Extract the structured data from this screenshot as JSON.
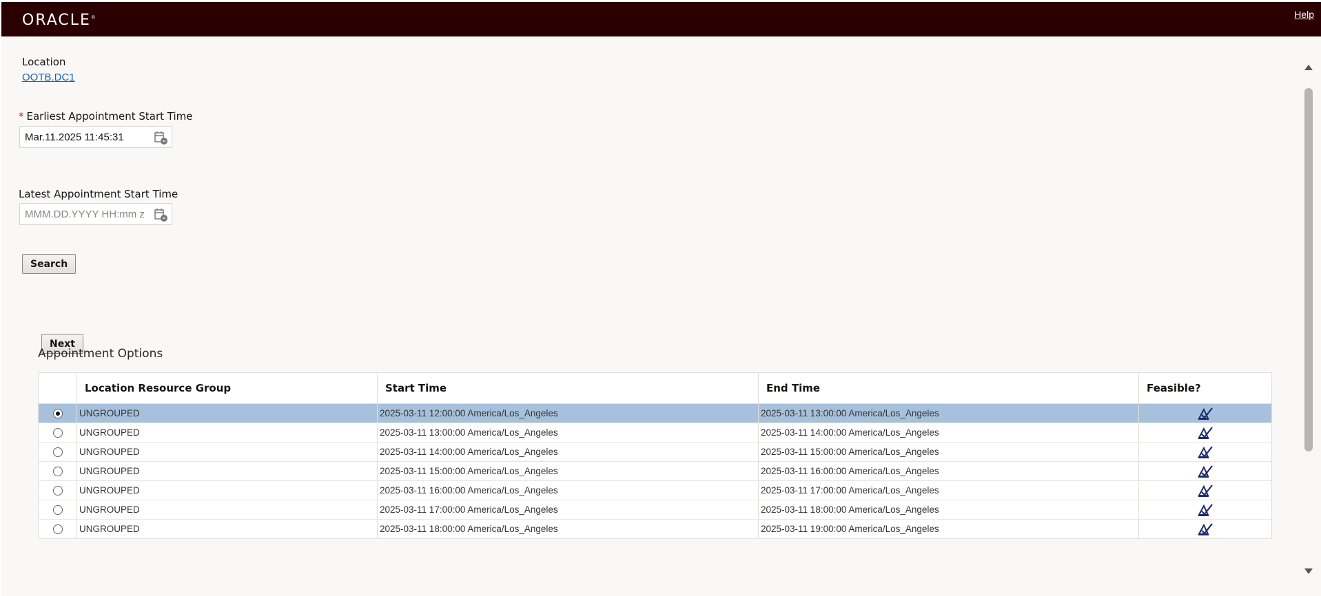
{
  "header": {
    "logo_text": "ORACLE",
    "logo_mark": "®",
    "help_label": "Help",
    "bar_color": "#2b0000"
  },
  "form": {
    "location_label": "Location",
    "location_value": "OOTB.DC1",
    "required_marker": "*",
    "earliest_label": "Earliest Appointment Start Time",
    "earliest_value": "Mar.11.2025 11:45:31",
    "latest_label": "Latest Appointment Start Time",
    "latest_placeholder": "MMM.DD.YYYY HH:mm z",
    "search_label": "Search"
  },
  "next_label": "Next",
  "appointments": {
    "title": "Appointment Options",
    "columns": [
      "Location Resource Group",
      "Start Time",
      "End Time",
      "Feasible?"
    ],
    "rows": [
      {
        "group": "UNGROUPED",
        "start": "2025-03-11 12:00:00 America/Los_Angeles",
        "end": "2025-03-11 13:00:00 America/Los_Angeles",
        "selected": true
      },
      {
        "group": "UNGROUPED",
        "start": "2025-03-11 13:00:00 America/Los_Angeles",
        "end": "2025-03-11 14:00:00 America/Los_Angeles",
        "selected": false
      },
      {
        "group": "UNGROUPED",
        "start": "2025-03-11 14:00:00 America/Los_Angeles",
        "end": "2025-03-11 15:00:00 America/Los_Angeles",
        "selected": false
      },
      {
        "group": "UNGROUPED",
        "start": "2025-03-11 15:00:00 America/Los_Angeles",
        "end": "2025-03-11 16:00:00 America/Los_Angeles",
        "selected": false
      },
      {
        "group": "UNGROUPED",
        "start": "2025-03-11 16:00:00 America/Los_Angeles",
        "end": "2025-03-11 17:00:00 America/Los_Angeles",
        "selected": false
      },
      {
        "group": "UNGROUPED",
        "start": "2025-03-11 17:00:00 America/Los_Angeles",
        "end": "2025-03-11 18:00:00 America/Los_Angeles",
        "selected": false
      },
      {
        "group": "UNGROUPED",
        "start": "2025-03-11 18:00:00 America/Los_Angeles",
        "end": "2025-03-11 19:00:00 America/Los_Angeles",
        "selected": false
      }
    ],
    "feasible_icon": "feasible-check-icon",
    "selected_row_color": "#a7c1dc"
  }
}
